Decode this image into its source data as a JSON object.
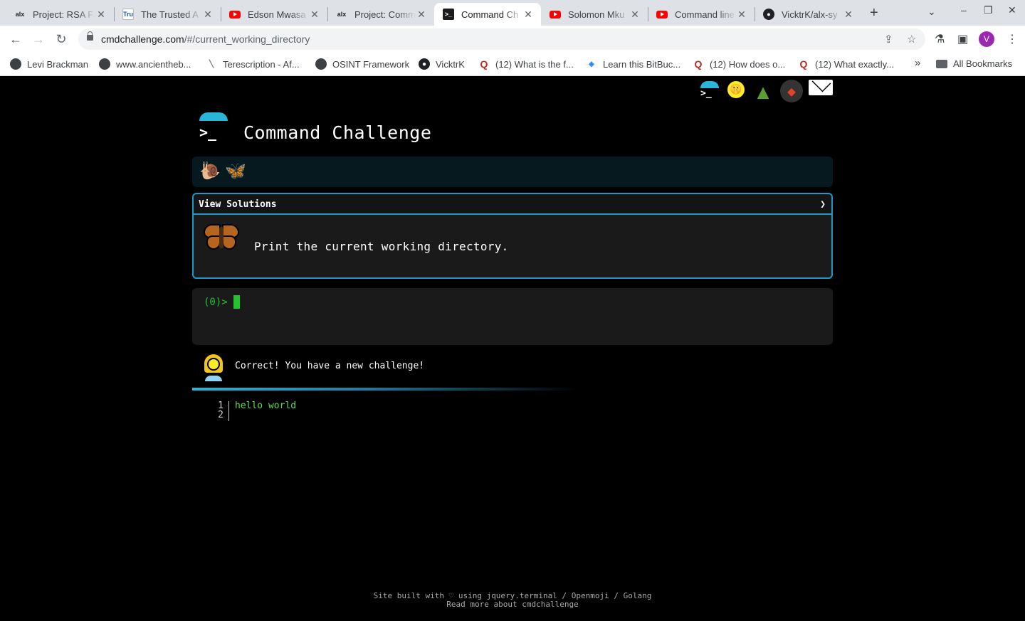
{
  "browser": {
    "tabs": [
      {
        "title": "Project: RSA Fa",
        "favicon": "alx-icon"
      },
      {
        "title": "The Trusted A",
        "favicon": "trusted-icon"
      },
      {
        "title": "Edson Mwasa",
        "favicon": "youtube-icon"
      },
      {
        "title": "Project: Comm",
        "favicon": "alx-icon"
      },
      {
        "title": "Command Ch",
        "favicon": "terminal-icon",
        "active": true
      },
      {
        "title": "Solomon Mku",
        "favicon": "youtube-icon"
      },
      {
        "title": "Command line",
        "favicon": "youtube-icon"
      },
      {
        "title": "VicktrK/alx-sy",
        "favicon": "github-icon"
      }
    ],
    "url_host": "cmdchallenge.com",
    "url_path": "/#/current_working_directory",
    "profile_initial": "V",
    "bookmarks": [
      {
        "label": "Levi Brackman",
        "icon": "globe-icon"
      },
      {
        "label": "www.ancientheb...",
        "icon": "globe-icon"
      },
      {
        "label": "Terescription - Af...",
        "icon": "pen-icon"
      },
      {
        "label": "OSINT Framework",
        "icon": "globe-icon"
      },
      {
        "label": "VicktrK",
        "icon": "github-icon"
      },
      {
        "label": "(12) What is the f...",
        "icon": "quora-icon"
      },
      {
        "label": "Learn this BitBuc...",
        "icon": "bitbucket-icon"
      },
      {
        "label": "(12) How does o...",
        "icon": "quora-icon"
      },
      {
        "label": "(12) What exactly...",
        "icon": "quora-icon"
      }
    ],
    "bookmarks_overflow": "»",
    "all_bookmarks": "All Bookmarks"
  },
  "site": {
    "title": "Command Challenge",
    "badges": [
      "snail-icon",
      "butterfly-icon"
    ],
    "challenge": {
      "header": "View Solutions",
      "chevron": "❯",
      "description": "Print the current working directory."
    },
    "terminal": {
      "prompt": "(0)>"
    },
    "notice": "Correct! You have a new challenge!",
    "editor": {
      "line_numbers": [
        "1",
        "2"
      ],
      "lines": [
        "hello world",
        ""
      ]
    },
    "footer": {
      "line1": "Site built with ♡ using jquery.terminal / Openmoji / Golang",
      "line2": "Read more about cmdchallenge"
    }
  },
  "colors": {
    "accent": "#2098c7",
    "terminal_green": "#22c42e",
    "page_bg": "#000000"
  }
}
